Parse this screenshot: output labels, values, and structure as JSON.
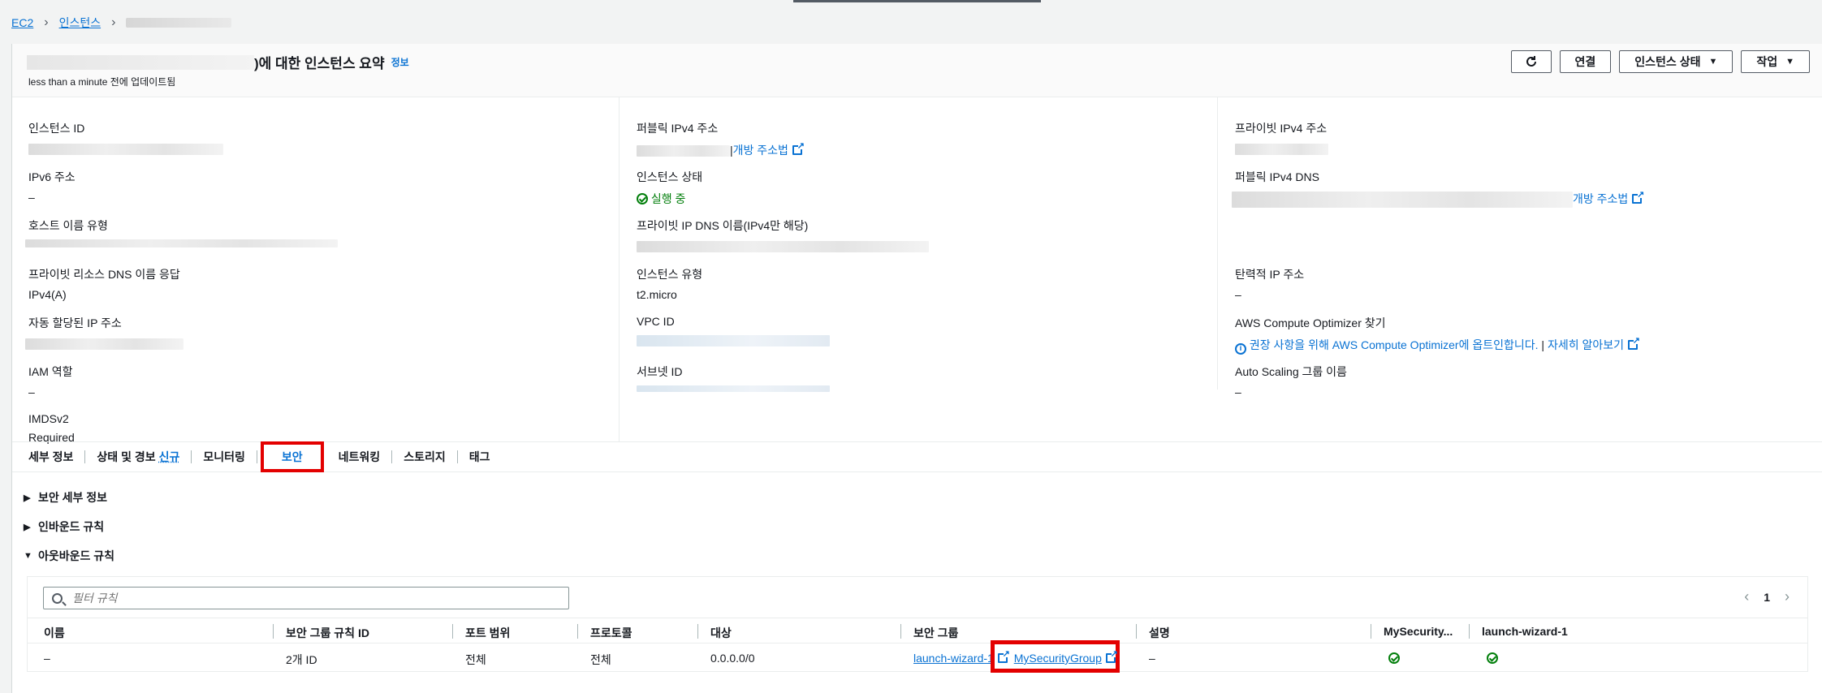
{
  "breadcrumb": {
    "root": "EC2",
    "section": "인스턴스"
  },
  "header": {
    "title_suffix": ")에 대한 인스턴스 요약",
    "info_label": "정보",
    "updated_text": "less than a minute 전에 업데이트됨",
    "connect_label": "연결",
    "instance_state_label": "인스턴스 상태",
    "actions_label": "작업"
  },
  "details": {
    "instance_id_label": "인스턴스 ID",
    "ipv6_label": "IPv6 주소",
    "ipv6_value": "–",
    "hostname_type_label": "호스트 이름 유형",
    "private_dns_answer_label": "프라이빗 리소스 DNS 이름 응답",
    "private_dns_answer_value": "IPv4(A)",
    "auto_ip_label": "자동 할당된 IP 주소",
    "iam_role_label": "IAM 역할",
    "iam_role_value": "–",
    "imdsv2_label": "IMDSv2",
    "imdsv2_value": "Required",
    "public_ipv4_label": "퍼블릭 IPv4 주소",
    "open_address_link": "개방 주소법",
    "instance_state_label": "인스턴스 상태",
    "instance_state_value": "실행 중",
    "private_ip_dns_label": "프라이빗 IP DNS 이름(IPv4만 해당)",
    "instance_type_label": "인스턴스 유형",
    "instance_type_value": "t2.micro",
    "vpc_id_label": "VPC ID",
    "subnet_id_label": "서브넷 ID",
    "private_ipv4_label": "프라이빗 IPv4 주소",
    "public_ipv4_dns_label": "퍼블릭 IPv4 DNS",
    "public_dns_link": "개방 주소법",
    "elastic_ip_label": "탄력적 IP 주소",
    "elastic_ip_value": "–",
    "optimizer_label": "AWS Compute Optimizer 찾기",
    "optimizer_link": "권장 사항을 위해 AWS Compute Optimizer에 옵트인합니다.",
    "optimizer_more": "자세히 알아보기",
    "asg_label": "Auto Scaling 그룹 이름",
    "asg_value": "–"
  },
  "tabs": {
    "details": "세부 정보",
    "status": "상태 및 경보",
    "status_badge": "신규",
    "monitoring": "모니터링",
    "security": "보안",
    "networking": "네트워킹",
    "storage": "스토리지",
    "tags": "태그"
  },
  "sections": {
    "security_details": "보안 세부 정보",
    "inbound": "인바운드 규칙",
    "outbound": "아웃바운드 규칙"
  },
  "rules_table": {
    "filter_placeholder": "필터 규칙",
    "page": "1",
    "columns": [
      "이름",
      "보안 그룹 규칙 ID",
      "포트 범위",
      "프로토콜",
      "대상",
      "보안 그룹",
      "설명",
      "MySecurity...",
      "launch-wizard-1"
    ],
    "row": {
      "name": "–",
      "rule_id": "2개 ID",
      "port_range": "전체",
      "protocol": "전체",
      "destination": "0.0.0.0/0",
      "sg_1": "launch-wizard-1",
      "sg_2": "MySecurityGroup",
      "description": "–"
    }
  },
  "colors": {
    "accent": "#0972d3",
    "highlight": "#e30000",
    "success": "#037f0c"
  }
}
